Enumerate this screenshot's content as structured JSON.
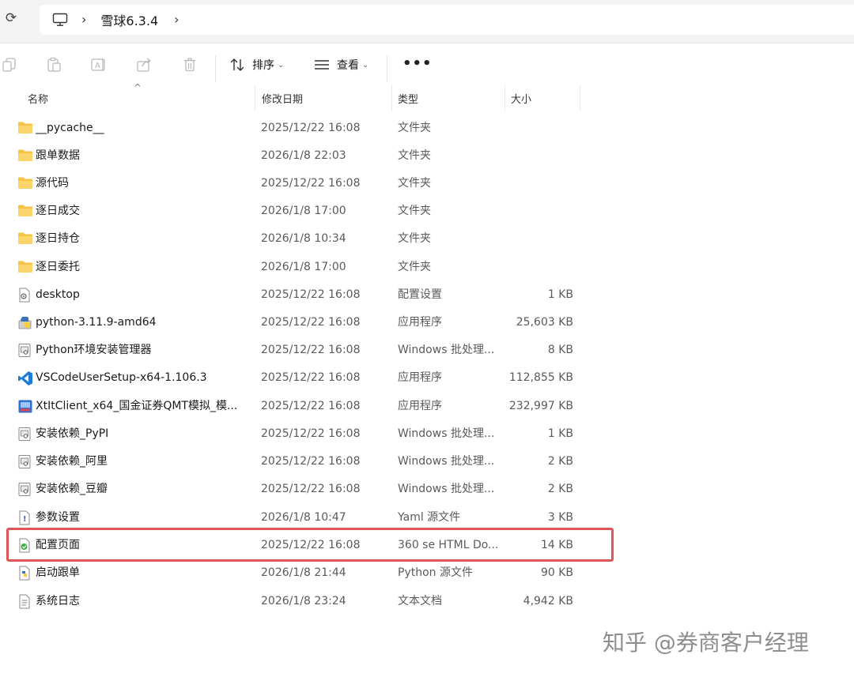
{
  "address": {
    "path_segment": "雪球6.3.4"
  },
  "toolbar": {
    "sort_label": "排序",
    "view_label": "查看",
    "more_label": "•••"
  },
  "columns": {
    "name": "名称",
    "modified": "修改日期",
    "type": "类型",
    "size": "大小"
  },
  "files": [
    {
      "name": "__pycache__",
      "modified": "2025/12/22 16:08",
      "type": "文件夹",
      "size": "",
      "icon": "folder-icon"
    },
    {
      "name": "跟单数据",
      "modified": "2026/1/8 22:03",
      "type": "文件夹",
      "size": "",
      "icon": "folder-icon"
    },
    {
      "name": "源代码",
      "modified": "2025/12/22 16:08",
      "type": "文件夹",
      "size": "",
      "icon": "folder-icon"
    },
    {
      "name": "逐日成交",
      "modified": "2026/1/8 17:00",
      "type": "文件夹",
      "size": "",
      "icon": "folder-icon"
    },
    {
      "name": "逐日持仓",
      "modified": "2026/1/8 10:34",
      "type": "文件夹",
      "size": "",
      "icon": "folder-icon"
    },
    {
      "name": "逐日委托",
      "modified": "2026/1/8 17:00",
      "type": "文件夹",
      "size": "",
      "icon": "folder-icon"
    },
    {
      "name": "desktop",
      "modified": "2025/12/22 16:08",
      "type": "配置设置",
      "size": "1 KB",
      "icon": "settings-file-icon"
    },
    {
      "name": "python-3.11.9-amd64",
      "modified": "2025/12/22 16:08",
      "type": "应用程序",
      "size": "25,603 KB",
      "icon": "python-installer-icon"
    },
    {
      "name": "Python环境安装管理器",
      "modified": "2025/12/22 16:08",
      "type": "Windows 批处理...",
      "size": "8 KB",
      "icon": "batch-file-icon"
    },
    {
      "name": "VSCodeUserSetup-x64-1.106.3",
      "modified": "2025/12/22 16:08",
      "type": "应用程序",
      "size": "112,855 KB",
      "icon": "vscode-icon"
    },
    {
      "name": "XtItClient_x64_国金证券QMT模拟_模...",
      "modified": "2025/12/22 16:08",
      "type": "应用程序",
      "size": "232,997 KB",
      "icon": "app-installer-icon"
    },
    {
      "name": "安装依赖_PyPI",
      "modified": "2025/12/22 16:08",
      "type": "Windows 批处理...",
      "size": "1 KB",
      "icon": "batch-file-icon"
    },
    {
      "name": "安装依赖_阿里",
      "modified": "2025/12/22 16:08",
      "type": "Windows 批处理...",
      "size": "2 KB",
      "icon": "batch-file-icon"
    },
    {
      "name": "安装依赖_豆瓣",
      "modified": "2025/12/22 16:08",
      "type": "Windows 批处理...",
      "size": "2 KB",
      "icon": "batch-file-icon"
    },
    {
      "name": "参数设置",
      "modified": "2026/1/8 10:47",
      "type": "Yaml 源文件",
      "size": "3 KB",
      "icon": "yaml-file-icon"
    },
    {
      "name": "配置页面",
      "modified": "2025/12/22 16:08",
      "type": "360 se HTML Do...",
      "size": "14 KB",
      "icon": "html-file-icon"
    },
    {
      "name": "启动跟单",
      "modified": "2026/1/8 21:44",
      "type": "Python 源文件",
      "size": "90 KB",
      "icon": "python-file-icon"
    },
    {
      "name": "系统日志",
      "modified": "2026/1/8 23:24",
      "type": "文本文档",
      "size": "4,942 KB",
      "icon": "text-file-icon"
    }
  ],
  "watermark": "知乎 @券商客户经理",
  "colors": {
    "folder": "#f5c242",
    "highlight_border": "#e05555",
    "vscode_blue": "#1e7bd6"
  }
}
